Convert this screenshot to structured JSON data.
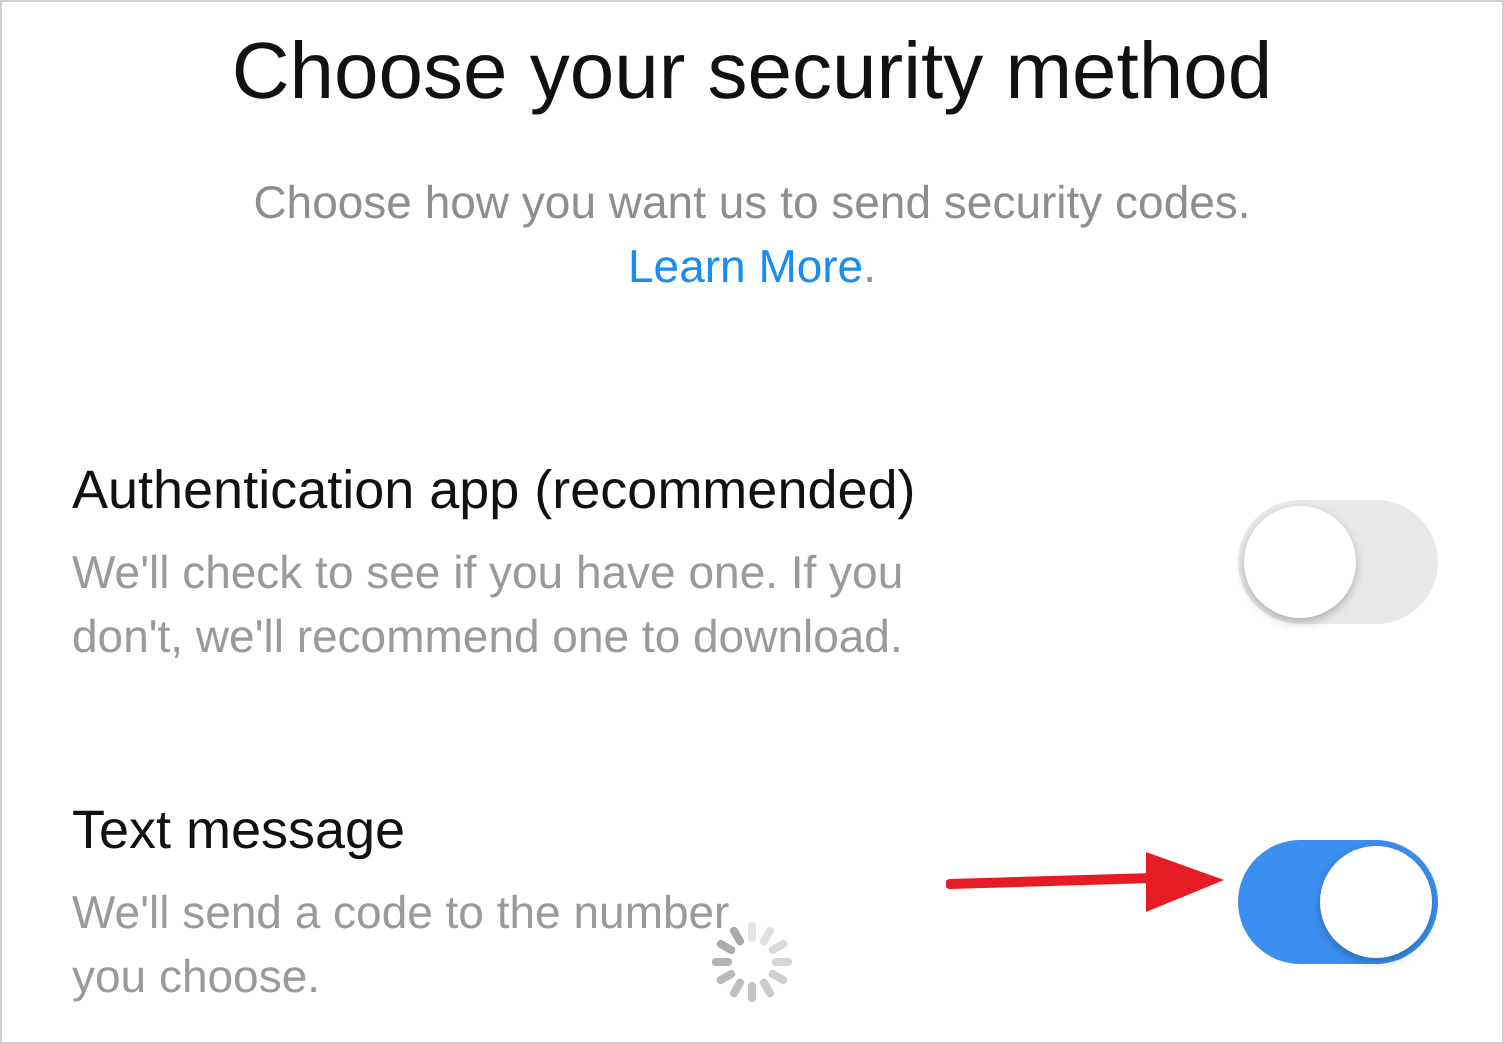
{
  "title": "Choose your security method",
  "subtitle": {
    "text": "Choose how you want us to send security codes.",
    "link": "Learn More",
    "after": "."
  },
  "options": [
    {
      "kind": "toggle",
      "label": "Authentication app (recommended)",
      "description_lines": [
        "We'll check to see if you have one. If you",
        "don't, we'll recommend one to download."
      ],
      "on": false,
      "pointed": false
    },
    {
      "kind": "toggle",
      "label": "Text message",
      "description_lines": [
        "We'll send a code to the number",
        "you choose."
      ],
      "on": true,
      "pointed": true
    }
  ],
  "loading": true
}
